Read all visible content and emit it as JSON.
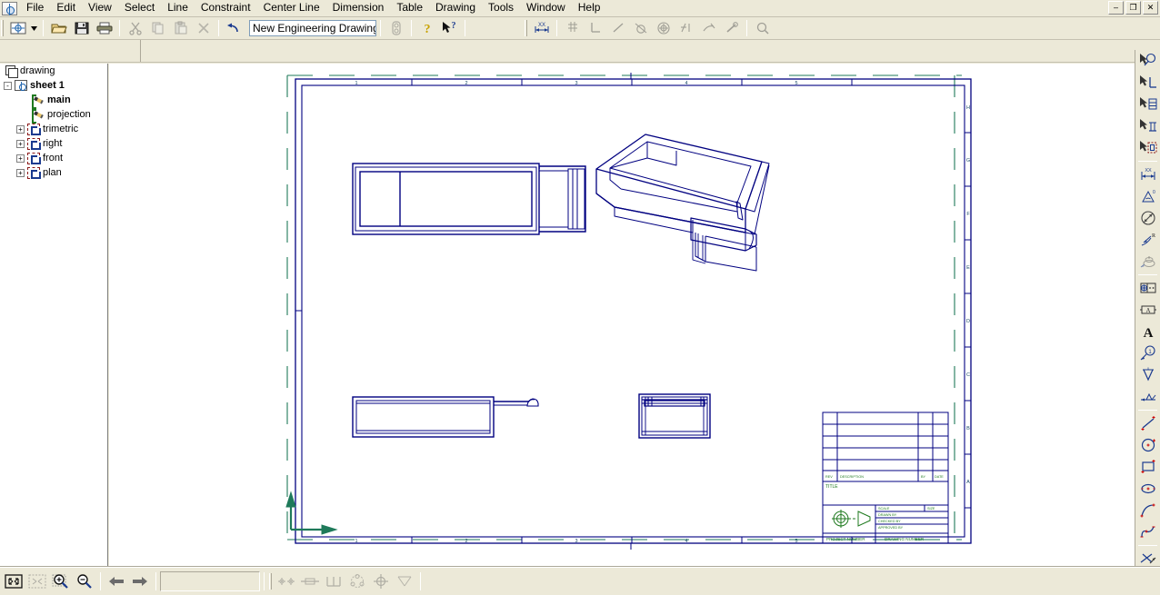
{
  "app": {
    "title": "New Engineering Drawing",
    "window_buttons": [
      {
        "name": "minimize",
        "glyph": "–"
      },
      {
        "name": "restore",
        "glyph": "❐"
      },
      {
        "name": "close",
        "glyph": "✕"
      }
    ]
  },
  "menu": {
    "items": [
      {
        "label": "File"
      },
      {
        "label": "Edit"
      },
      {
        "label": "View"
      },
      {
        "label": "Select"
      },
      {
        "label": "Line"
      },
      {
        "label": "Constraint"
      },
      {
        "label": "Center Line"
      },
      {
        "label": "Dimension"
      },
      {
        "label": "Table"
      },
      {
        "label": "Drawing"
      },
      {
        "label": "Tools"
      },
      {
        "label": "Window"
      },
      {
        "label": "Help"
      }
    ]
  },
  "toolbar": {
    "document_name": "New Engineering Drawing",
    "buttons": [
      {
        "name": "new-drawing",
        "icon": "new-drawing-icon",
        "enabled": true
      },
      {
        "name": "new-drawing-dropdown",
        "icon": "chevron-down-icon",
        "enabled": true
      },
      {
        "name": "open",
        "icon": "folder-open-icon",
        "enabled": true
      },
      {
        "name": "save",
        "icon": "floppy-disk-icon",
        "enabled": true
      },
      {
        "name": "print",
        "icon": "printer-icon",
        "enabled": true
      },
      {
        "name": "cut",
        "icon": "scissors-icon",
        "enabled": false
      },
      {
        "name": "copy",
        "icon": "copy-icon",
        "enabled": false
      },
      {
        "name": "paste",
        "icon": "clipboard-icon",
        "enabled": false
      },
      {
        "name": "delete",
        "icon": "x-mark-icon",
        "enabled": false
      },
      {
        "name": "undo",
        "icon": "undo-arrow-icon",
        "enabled": true
      },
      {
        "name": "properties",
        "icon": "properties-icon",
        "enabled": false
      },
      {
        "name": "help",
        "icon": "question-mark-icon",
        "enabled": true
      },
      {
        "name": "context-help",
        "icon": "arrow-question-icon",
        "enabled": true
      },
      {
        "name": "dimension-tool",
        "icon": "linear-dimension-icon",
        "enabled": true
      },
      {
        "name": "point-constraint",
        "icon": "point-constraint-icon",
        "enabled": false
      },
      {
        "name": "perpendicular-constraint",
        "icon": "perpendicular-icon",
        "enabled": false
      },
      {
        "name": "collinear-constraint",
        "icon": "line-icon",
        "enabled": false
      },
      {
        "name": "tangent-constraint",
        "icon": "tangent-circle-icon",
        "enabled": false
      },
      {
        "name": "concentric-constraint",
        "icon": "concentric-circle-icon",
        "enabled": false
      },
      {
        "name": "equal-constraint",
        "icon": "equal-length-icon",
        "enabled": false
      },
      {
        "name": "parallel-constraint",
        "icon": "parallel-icon",
        "enabled": false
      },
      {
        "name": "fix-constraint",
        "icon": "anchor-pin-icon",
        "enabled": false
      },
      {
        "name": "inspect",
        "icon": "magnifier-icon",
        "enabled": false
      }
    ]
  },
  "tree": {
    "nodes": [
      {
        "label": "drawing",
        "icon": "drawing-root-icon",
        "depth": 0,
        "expander": "",
        "bold": false
      },
      {
        "label": "sheet 1",
        "icon": "sheet-icon",
        "depth": 1,
        "expander": "-",
        "bold": true
      },
      {
        "label": "main",
        "icon": "view-pencil-icon",
        "depth": 2,
        "expander": "",
        "bold": true
      },
      {
        "label": "projection",
        "icon": "view-pencil-icon",
        "depth": 2,
        "expander": "",
        "bold": false
      },
      {
        "label": "trimetric",
        "icon": "projection-view-icon",
        "depth": 2,
        "expander": "+",
        "bold": false
      },
      {
        "label": "right",
        "icon": "projection-view-icon",
        "depth": 2,
        "expander": "+",
        "bold": false
      },
      {
        "label": "front",
        "icon": "projection-view-icon",
        "depth": 2,
        "expander": "+",
        "bold": false
      },
      {
        "label": "plan",
        "icon": "projection-view-icon",
        "depth": 2,
        "expander": "+",
        "bold": false
      }
    ]
  },
  "sheet": {
    "zone_numbers_top": [
      "1",
      "2",
      "3",
      "4",
      "5"
    ],
    "zone_numbers_bottom": [
      "1",
      "2",
      "3",
      "4",
      "5"
    ],
    "zone_letters_right": [
      "H",
      "G",
      "F",
      "E",
      "D",
      "C",
      "B",
      "A"
    ],
    "border_color": "#000080",
    "trim_mark_color": "#1f7a5a",
    "origin_axis_color": "#1f7a5a",
    "geometry_color": "#000080",
    "title_block_color": "#1f7a1f"
  },
  "title_block": {
    "revision_header": {
      "rev": "REV",
      "description": "DESCRIPTION",
      "by": "BY",
      "date": "DATE"
    },
    "title_label": "TITLE",
    "fields": [
      {
        "label": "SCALE",
        "value2_label": "SIZE"
      },
      {
        "label": "DRAWN BY",
        "value2_label": ""
      },
      {
        "label": "CHECKED BY",
        "value2_label": ""
      },
      {
        "label": "APPROVED BY",
        "value2_label": ""
      }
    ],
    "project_number_label": "PROJECT NUMBER",
    "drawing_number_label": "DRAWING NUMBER",
    "projection_symbol": "first-angle-projection-symbol"
  },
  "right_toolbar": {
    "buttons": [
      {
        "name": "select-dimension",
        "icon": "select-dimension-icon"
      },
      {
        "name": "select-perpendicular",
        "icon": "select-perpendicular-icon"
      },
      {
        "name": "select-table",
        "icon": "select-table-icon"
      },
      {
        "name": "select-datum",
        "icon": "select-datum-icon"
      },
      {
        "name": "select-view",
        "icon": "select-view-icon"
      },
      {
        "name": "linear-dimension",
        "icon": "linear-dimension-icon"
      },
      {
        "name": "angular-dimension",
        "icon": "angular-dimension-icon"
      },
      {
        "name": "diameter-dimension",
        "icon": "diameter-dimension-icon"
      },
      {
        "name": "radial-dimension",
        "icon": "radial-dimension-icon"
      },
      {
        "name": "ordinate-dimension",
        "icon": "ordinate-dimension-icon"
      },
      {
        "name": "feature-control-frame",
        "icon": "feature-control-frame-icon"
      },
      {
        "name": "datum-feature",
        "icon": "datum-feature-icon"
      },
      {
        "name": "text-note",
        "icon": "text-icon"
      },
      {
        "name": "balloon",
        "icon": "balloon-icon"
      },
      {
        "name": "surface-finish",
        "icon": "surface-finish-icon"
      },
      {
        "name": "weld-symbol",
        "icon": "weld-symbol-icon"
      },
      {
        "name": "draw-line",
        "icon": "line-icon"
      },
      {
        "name": "draw-circle",
        "icon": "circle-icon"
      },
      {
        "name": "draw-rectangle",
        "icon": "rectangle-icon"
      },
      {
        "name": "draw-ellipse",
        "icon": "ellipse-icon"
      },
      {
        "name": "draw-arc",
        "icon": "arc-icon"
      },
      {
        "name": "draw-spline",
        "icon": "spline-icon"
      },
      {
        "name": "trim",
        "icon": "trim-icon"
      }
    ]
  },
  "status_bar": {
    "buttons": [
      {
        "name": "zoom-fit",
        "icon": "zoom-fit-icon",
        "enabled": true
      },
      {
        "name": "zoom-selection",
        "icon": "zoom-selection-icon",
        "enabled": false
      },
      {
        "name": "zoom-in",
        "icon": "zoom-in-icon",
        "enabled": true
      },
      {
        "name": "zoom-out",
        "icon": "zoom-out-icon",
        "enabled": true
      },
      {
        "name": "view-back",
        "icon": "arrow-left-icon",
        "enabled": true
      },
      {
        "name": "view-forward",
        "icon": "arrow-right-icon",
        "enabled": true
      },
      {
        "name": "center-mark",
        "icon": "center-mark-icon",
        "enabled": false
      },
      {
        "name": "center-line",
        "icon": "center-line-icon",
        "enabled": false
      },
      {
        "name": "center-line-pattern",
        "icon": "center-line-pattern-icon",
        "enabled": false
      },
      {
        "name": "bolt-circle",
        "icon": "bolt-circle-icon",
        "enabled": false
      },
      {
        "name": "center-cross",
        "icon": "center-cross-icon",
        "enabled": false
      },
      {
        "name": "projection-line",
        "icon": "projection-line-icon",
        "enabled": false
      }
    ],
    "message": ""
  }
}
